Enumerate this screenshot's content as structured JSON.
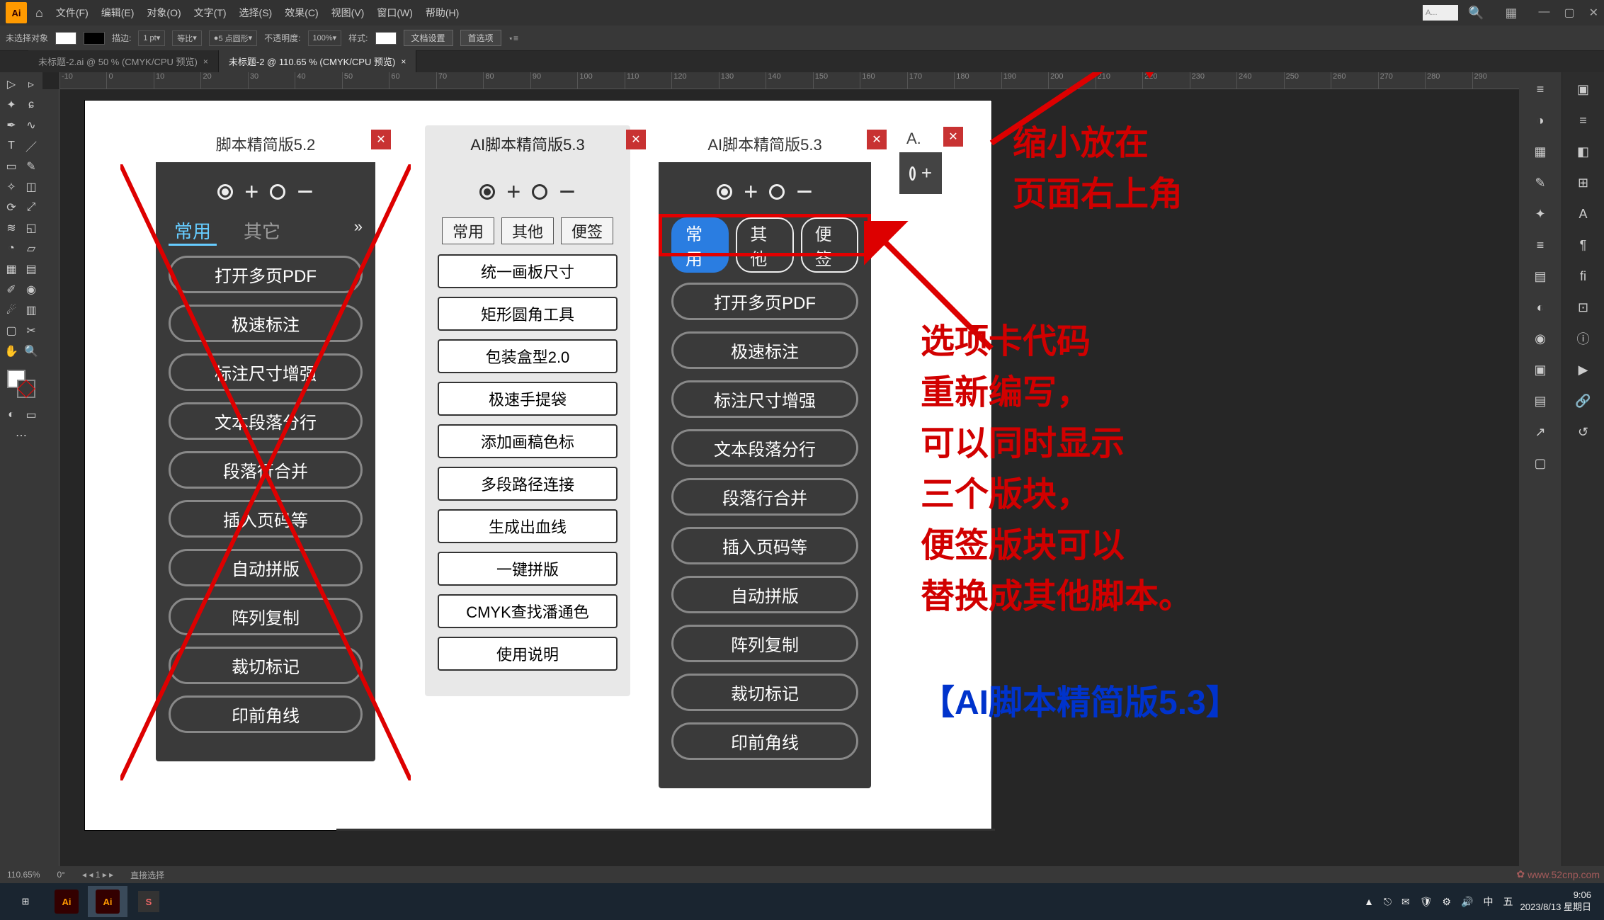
{
  "menu": {
    "items": [
      "文件(F)",
      "编辑(E)",
      "对象(O)",
      "文字(T)",
      "选择(S)",
      "效果(C)",
      "视图(V)",
      "窗口(W)",
      "帮助(H)"
    ],
    "search_placeholder": "A..."
  },
  "control_bar": {
    "no_sel": "未选择对象",
    "stroke_label": "描边:",
    "stroke_val": "1 pt",
    "uniform": "等比",
    "preset": "5 点圆形",
    "opacity_label": "不透明度:",
    "opacity_val": "100%",
    "style_label": "样式:",
    "doc_setup": "文档设置",
    "prefs": "首选项"
  },
  "tabs": {
    "t1": "未标题-2.ai @ 50 % (CMYK/CPU 预览)",
    "t2": "未标题-2 @ 110.65 % (CMYK/CPU 预览)"
  },
  "ruler_marks": [
    "-10",
    "0",
    "10",
    "20",
    "30",
    "40",
    "50",
    "60",
    "70",
    "80",
    "90",
    "100",
    "110",
    "120",
    "130",
    "140",
    "150",
    "160",
    "170",
    "180",
    "190",
    "200",
    "210",
    "220",
    "230",
    "240",
    "250",
    "260",
    "270",
    "280",
    "290"
  ],
  "panel1": {
    "title": "脚本精简版5.2",
    "tabs": [
      "常用",
      "其它"
    ],
    "buttons": [
      "打开多页PDF",
      "极速标注",
      "标注尺寸增强",
      "文本段落分行",
      "段落行合并",
      "插入页码等",
      "自动拼版",
      "阵列复制",
      "裁切标记",
      "印前角线"
    ]
  },
  "panel2": {
    "title": "AI脚本精简版5.3",
    "tabs": [
      "常用",
      "其他",
      "便签"
    ],
    "buttons": [
      "统一画板尺寸",
      "矩形圆角工具",
      "包装盒型2.0",
      "极速手提袋",
      "添加画稿色标",
      "多段路径连接",
      "生成出血线",
      "一键拼版",
      "CMYK查找潘通色",
      "使用说明"
    ]
  },
  "panel3": {
    "title": "AI脚本精简版5.3",
    "tabs": [
      "常用",
      "其他",
      "便签"
    ],
    "buttons": [
      "打开多页PDF",
      "极速标注",
      "标注尺寸增强",
      "文本段落分行",
      "段落行合并",
      "插入页码等",
      "自动拼版",
      "阵列复制",
      "裁切标记",
      "印前角线"
    ]
  },
  "panel4": {
    "title": "A."
  },
  "annotations": {
    "top1": "缩小放在",
    "top2": "页面右上角",
    "mid_lines": [
      "选项卡代码",
      "重新编写，",
      "可以同时显示",
      "三个版块，",
      "便签版块可以",
      "替换成其他脚本。"
    ],
    "bottom": "【AI脚本精简版5.3】"
  },
  "status": {
    "zoom": "110.65%",
    "rot": "0°",
    "artboard": "1",
    "tool": "直接选择"
  },
  "taskbar": {
    "time": "9:06",
    "date": "2023/8/13 星期日"
  },
  "watermark": "www.52cnp.com"
}
